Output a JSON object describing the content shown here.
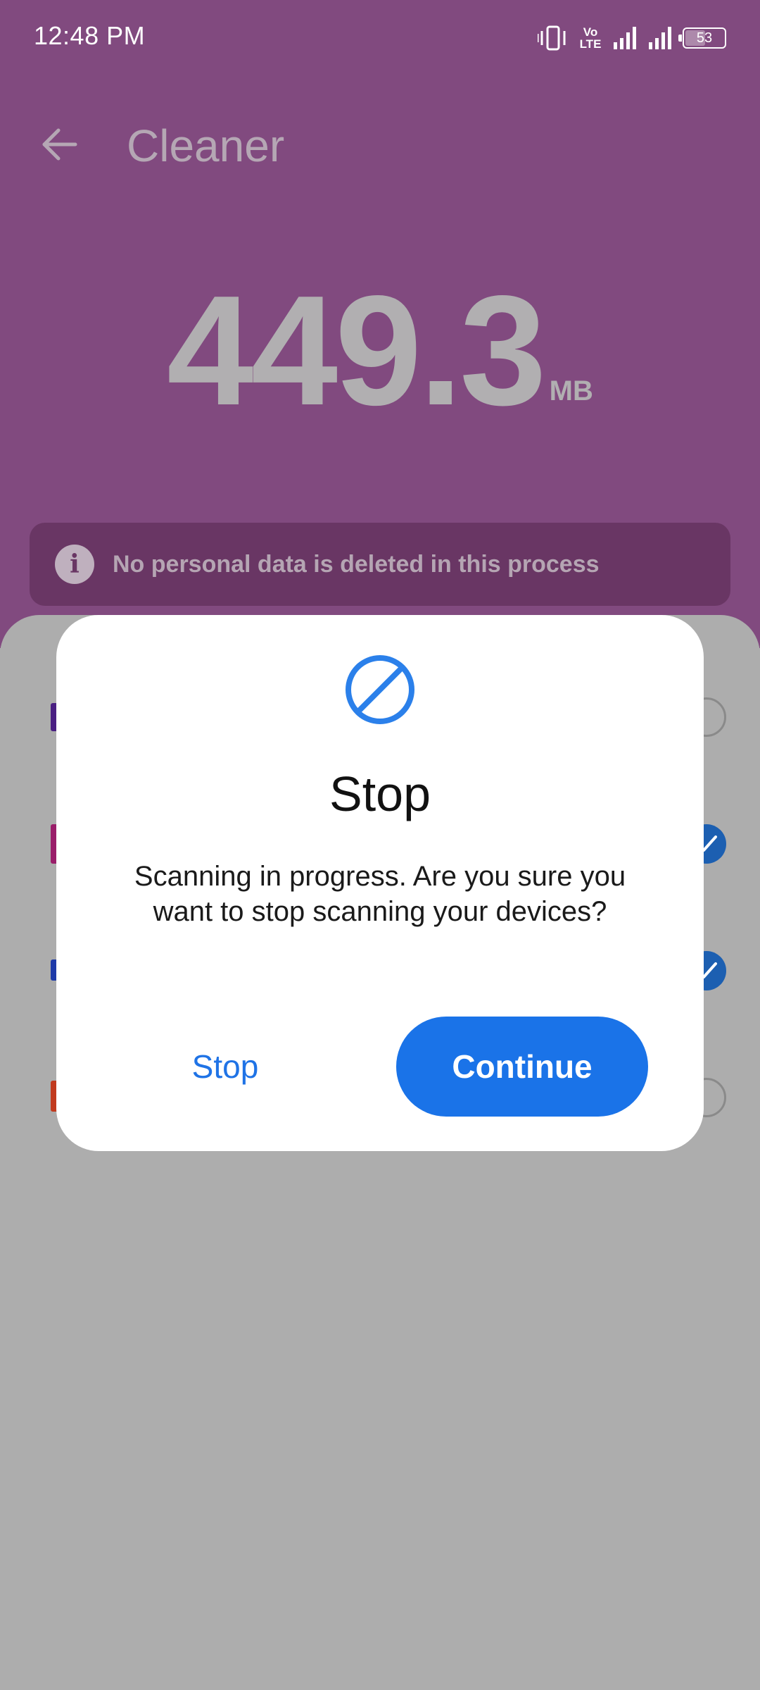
{
  "status_bar": {
    "time": "12:48 PM",
    "network_label_top": "Vo",
    "network_label_bottom": "LTE",
    "battery_level": "53",
    "battery_fraction": 0.53
  },
  "toolbar": {
    "title": "Cleaner",
    "back_icon": "arrow-left-icon"
  },
  "scan": {
    "size_value": "449.3",
    "size_unit": "MB"
  },
  "info_banner": {
    "icon": "info-icon",
    "text": "No personal data is deleted in this process"
  },
  "list": {
    "items": [
      {
        "icon_color": "#4a1f82",
        "checked": false
      },
      {
        "icon_color": "#9a1e6a",
        "checked": true
      },
      {
        "icon_color": "#1e3aa8",
        "checked": true
      },
      {
        "icon_color": "#c13a1e",
        "checked": false
      }
    ]
  },
  "dialog": {
    "icon": "block-icon",
    "title": "Stop",
    "message": "Scanning in progress. Are you sure you want to stop scanning your devices?",
    "stop_label": "Stop",
    "continue_label": "Continue"
  },
  "colors": {
    "accent": "#1a73e8",
    "header_bg": "#814a7f",
    "scrim_bg": "#adadad"
  }
}
